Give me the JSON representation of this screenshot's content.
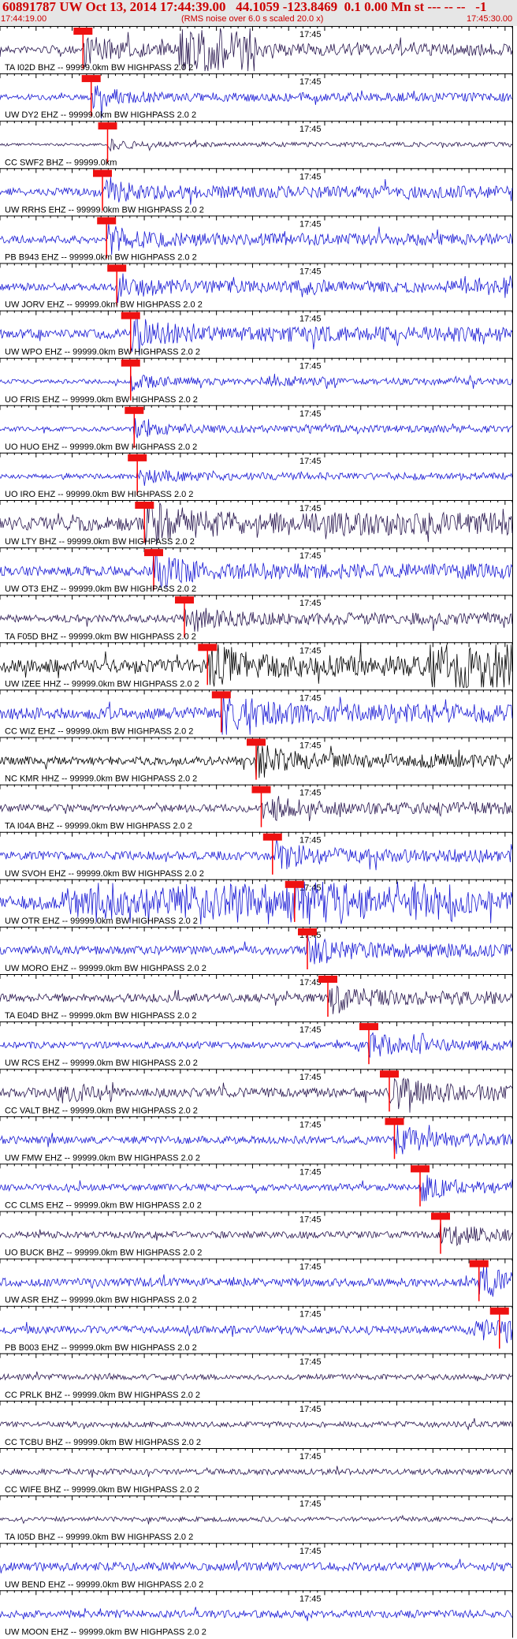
{
  "header": {
    "title": "60891787 UW Oct 13, 2014 17:44:39.00   44.1059 -123.8469  0.1 0.00 Mn st --- -- --   -1",
    "start_time": "17:44:19.00",
    "scale_note": "(RMS noise over 6.0 s scaled 20.0 x)",
    "end_time": "17:45:30.00"
  },
  "time_axis": {
    "mid_label": "17:45"
  },
  "colors": {
    "header_text": "#cc0000",
    "header_bg": "#e6e6e6",
    "blue_trace": "#1a1ad4",
    "dark_trace": "#2a1850",
    "black_trace": "#000000",
    "pick_marker": "#ff0000",
    "pick_box": "#ee1111"
  },
  "traces": [
    {
      "label": "TA I02D BHZ -- 99999.0km BW  HIGHPASS  2.0  2",
      "color": "dark",
      "pick": 0.162,
      "burst": [
        [
          0.35,
          0.5,
          6
        ],
        [
          0.47,
          0.52,
          2
        ]
      ],
      "amp": 0.16
    },
    {
      "label": "UW DY2 EHZ -- 99999.0km BW  HIGHPASS  2.0  2",
      "color": "blue",
      "pick": 0.178,
      "amp": 0.12
    },
    {
      "label": "CC SWF2 BHZ -- 99999.0km",
      "color": "dark",
      "pick": 0.21,
      "amp": 0.06
    },
    {
      "label": "UW RRHS EHZ -- 99999.0km BW  HIGHPASS  2.0  2",
      "color": "blue",
      "pick": 0.2,
      "amp": 0.16
    },
    {
      "label": "PB B943 EHZ -- 99999.0km BW  HIGHPASS  2.0  2",
      "color": "blue",
      "pick": 0.208,
      "amp": 0.16
    },
    {
      "label": "UW JORV EHZ -- 99999.0km BW  HIGHPASS  2.0  2",
      "color": "blue",
      "pick": 0.228,
      "burst": [
        [
          0.58,
          0.64,
          2
        ],
        [
          0.9,
          1.0,
          2.4
        ]
      ],
      "amp": 0.16
    },
    {
      "label": "UW WPO EHZ -- 99999.0km BW  HIGHPASS  2.0  2",
      "color": "blue",
      "pick": 0.255,
      "burst": [
        [
          0.26,
          0.4,
          1.8
        ]
      ],
      "amp": 0.2
    },
    {
      "label": "UO FRIS EHZ -- 99999.0km BW  HIGHPASS  2.0  2",
      "color": "blue",
      "pick": 0.255,
      "burst": [
        [
          0.5,
          0.66,
          2.2
        ]
      ],
      "amp": 0.09
    },
    {
      "label": "UO HUO EHZ -- 99999.0km BW  HIGHPASS  2.0  2",
      "color": "blue",
      "pick": 0.262,
      "burst": [
        [
          0.58,
          0.66,
          1.6
        ]
      ],
      "amp": 0.1
    },
    {
      "label": "UO IRO EHZ -- 99999.0km BW  HIGHPASS  2.0  2",
      "color": "blue",
      "pick": 0.268,
      "burst": [
        [
          0.58,
          0.62,
          1.6
        ],
        [
          0.12,
          0.14,
          1.6
        ]
      ],
      "amp": 0.1
    },
    {
      "label": "UW LTY BHZ -- 99999.0km BW  HIGHPASS  2.0  2",
      "color": "dark",
      "pick": 0.282,
      "amp": 0.3
    },
    {
      "label": "UW OT3 EHZ -- 99999.0km BW  HIGHPASS  2.0  2",
      "color": "blue",
      "pick": 0.3,
      "amp": 0.2
    },
    {
      "label": "TA F05D BHZ -- 99999.0km BW  HIGHPASS  2.0  2",
      "color": "dark",
      "pick": 0.36,
      "amp": 0.16
    },
    {
      "label": "UW IZEE HHZ -- 99999.0km BW  HIGHPASS  2.0  2",
      "color": "black",
      "pick": 0.405,
      "burst": [
        [
          0.84,
          1.0,
          4
        ]
      ],
      "amp": 0.28
    },
    {
      "label": "CC WIZ EHZ -- 99999.0km BW  HIGHPASS  2.0  2",
      "color": "blue",
      "pick": 0.432,
      "amp": 0.25
    },
    {
      "label": "NC KMR HHZ -- 99999.0km BW  HIGHPASS  2.0  2",
      "color": "black",
      "pick": 0.5,
      "amp": 0.18
    },
    {
      "label": "TA I04A BHZ -- 99999.0km BW  HIGHPASS  2.0  2",
      "color": "dark",
      "pick": 0.51,
      "amp": 0.16
    },
    {
      "label": "UW SVOH EHZ -- 99999.0km BW  HIGHPASS  2.0  2",
      "color": "blue",
      "pick": 0.532,
      "amp": 0.18
    },
    {
      "label": "UW OTR EHZ -- 99999.0km BW  HIGHPASS  2.0  2",
      "color": "blue",
      "pick": 0.575,
      "burst": [
        [
          0.12,
          0.9,
          2.4
        ]
      ],
      "amp": 0.3
    },
    {
      "label": "UW MORO EHZ -- 99999.0km BW  HIGHPASS  2.0  2",
      "color": "blue",
      "pick": 0.6,
      "amp": 0.18
    },
    {
      "label": "TA E04D BHZ -- 99999.0km BW  HIGHPASS  2.0  2",
      "color": "dark",
      "pick": 0.64,
      "amp": 0.18
    },
    {
      "label": "UW RCS EHZ -- 99999.0km BW  HIGHPASS  2.0  2",
      "color": "blue",
      "pick": 0.72,
      "burst": [
        [
          0.8,
          0.83,
          3
        ]
      ],
      "amp": 0.14
    },
    {
      "label": "CC VALT BHZ -- 99999.0km BW  HIGHPASS  2.0  2",
      "color": "dark",
      "pick": 0.76,
      "burst": [
        [
          0.1,
          0.22,
          1.8
        ],
        [
          0.9,
          0.99,
          1.6
        ]
      ],
      "amp": 0.2
    },
    {
      "label": "UW FMW EHZ -- 99999.0km BW  HIGHPASS  2.0  2",
      "color": "blue",
      "pick": 0.77,
      "amp": 0.16
    },
    {
      "label": "CC CLMS EHZ -- 99999.0km BW  HIGHPASS  2.0  2",
      "color": "blue",
      "pick": 0.82,
      "amp": 0.14
    },
    {
      "label": "UO BUCK BHZ -- 99999.0km BW  HIGHPASS  2.0  2",
      "color": "dark",
      "pick": 0.86,
      "amp": 0.14
    },
    {
      "label": "UW ASR EHZ -- 99999.0km BW  HIGHPASS  2.0  2",
      "color": "blue",
      "pick": 0.935,
      "amp": 0.18
    },
    {
      "label": "PB B003 EHZ -- 99999.0km BW  HIGHPASS  2.0  2",
      "color": "blue",
      "pick": 0.975,
      "burst": [
        [
          0.9,
          1.0,
          2.4
        ]
      ],
      "amp": 0.16
    },
    {
      "label": "CC PRLK BHZ -- 99999.0km BW  HIGHPASS  2.0  2",
      "color": "dark",
      "amp": 0.12
    },
    {
      "label": "CC TCBU BHZ -- 99999.0km BW  HIGHPASS  2.0  2",
      "color": "dark",
      "amp": 0.12
    },
    {
      "label": "CC WIFE BHZ -- 99999.0km BW  HIGHPASS  2.0  2",
      "color": "dark",
      "amp": 0.12
    },
    {
      "label": "TA I05D BHZ -- 99999.0km BW  HIGHPASS  2.0  2",
      "color": "dark",
      "amp": 0.1
    },
    {
      "label": "UW BEND EHZ -- 99999.0km BW  HIGHPASS  2.0  2",
      "color": "blue",
      "amp": 0.18
    },
    {
      "label": "UW MOON EHZ -- 99999.0km BW  HIGHPASS  2.0  2",
      "color": "blue",
      "amp": 0.16
    }
  ]
}
